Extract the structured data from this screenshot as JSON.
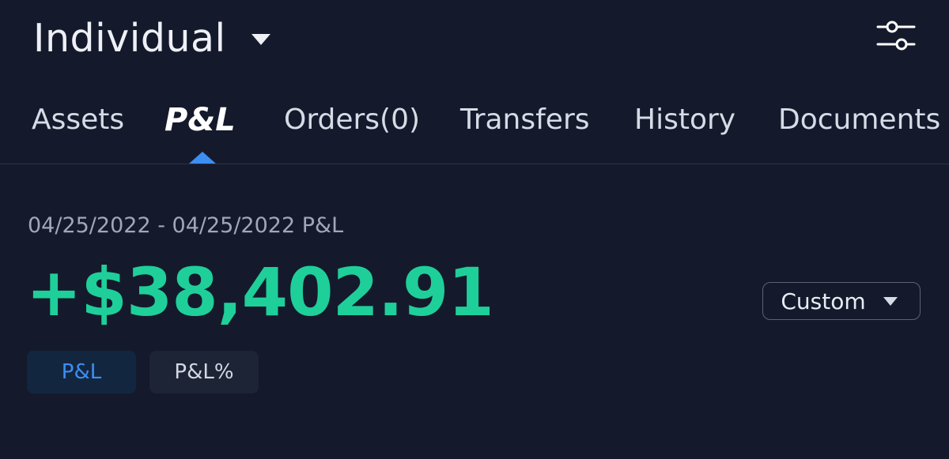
{
  "header": {
    "account_name": "Individual",
    "caret_icon": "caret-down-icon",
    "settings_icon": "sliders-icon"
  },
  "tabs": [
    {
      "label": "Assets",
      "active": false
    },
    {
      "label": "P&L",
      "active": true
    },
    {
      "label": "Orders(0)",
      "active": false
    },
    {
      "label": "Transfers",
      "active": false
    },
    {
      "label": "History",
      "active": false
    },
    {
      "label": "Documents",
      "active": false
    }
  ],
  "summary": {
    "date_range": "04/25/2022 - 04/25/2022 P&L",
    "pnl_value": "+$38,402.91",
    "period": "Custom"
  },
  "toggles": {
    "pnl_label": "P&L",
    "pnl_pct_label": "P&L%",
    "selected": "P&L"
  },
  "colors": {
    "background": "#141a2c",
    "accent": "#3d8ef2",
    "gain": "#1fcf99",
    "text": "#e9ecf3",
    "muted": "#a0a7b8"
  }
}
